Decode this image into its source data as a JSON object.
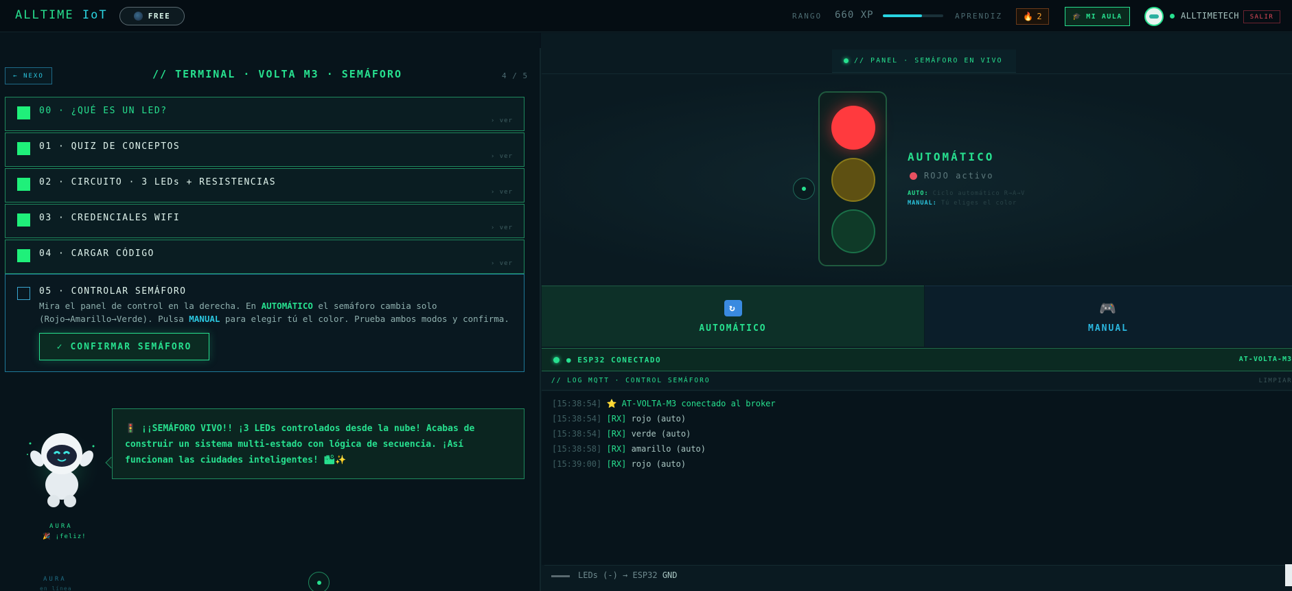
{
  "topbar": {
    "brand_main": "ALLTIME",
    "brand_iot": "IoT",
    "plan_label": "FREE",
    "rank_label": "RANGO",
    "xp_label": "660 XP",
    "xp_progress": 0.65,
    "level_label": "APRENDIZ",
    "streak_count": "2",
    "classroom_label": "MI AULA",
    "username": "ALLTIMETECH",
    "logout_label": "SALIR"
  },
  "lesson": {
    "back_label": "← NEXO",
    "title": "// TERMINAL · VOLTA M3 · SEMÁFORO",
    "progress": "4 / 5",
    "steps": [
      {
        "label": "00 · ¿QUÉ ES UN LED?",
        "view": "› ver"
      },
      {
        "label": "01 · QUIZ DE CONCEPTOS",
        "view": "› ver"
      },
      {
        "label": "02 · CIRCUITO · 3 LEDs + RESISTENCIAS",
        "view": "› ver"
      },
      {
        "label": "03 · CREDENCIALES WIFI",
        "view": "› ver"
      },
      {
        "label": "04 · CARGAR CÓDIGO",
        "view": "› ver"
      }
    ],
    "active_step": {
      "label": "05 · CONTROLAR SEMÁFORO",
      "desc_1": "Mira el panel de control en la derecha. En ",
      "desc_auto": "AUTOMÁTICO",
      "desc_2": " el semáforo cambia solo (Rojo→Amarillo→Verde). Pulsa ",
      "desc_manual": "MANUAL",
      "desc_3": " para elegir tú el color. Prueba ambos modos y confirma.",
      "confirm_label": "CONFIRMAR SEMÁFORO",
      "confirm_check": "✓"
    }
  },
  "mascot": {
    "message": "🚦 ¡¡SEMÁFORO VIVO!! ¡3 LEDs controlados desde la nube! Acabas de construir un sistema multi-estado con lógica de secuencia. ¡Así funcionan las ciudades inteligentes! 🏙✨",
    "name": "AURA",
    "mood": "🎉 ¡feliz!",
    "name_footer": "AURA",
    "status_footer": "en línea"
  },
  "panel": {
    "tab_label": "// PANEL · SEMÁFORO EN VIVO",
    "mode_title": "AUTOMÁTICO",
    "mode_state": "ROJO activo",
    "legend_auto_key": "AUTO:",
    "legend_auto_val": "Ciclo automático R→A→V",
    "legend_manual_key": "MANUAL:",
    "legend_manual_val": "Tú eliges el color",
    "btn_auto": "AUTOMÁTICO",
    "btn_manual": "MANUAL",
    "connection_label": "● ESP32 CONECTADO",
    "device_id": "AT-VOLTA-M3",
    "log_title": "// LOG MQTT · CONTROL SEMÁFORO",
    "log_clear": "LIMPIAR",
    "log": [
      {
        "ts": "[15:38:54]",
        "tag": "⭐",
        "msg": "AT-VOLTA-M3 conectado al broker",
        "highlight": true
      },
      {
        "ts": "[15:38:54]",
        "tag": "[RX]",
        "msg": "rojo (auto)",
        "highlight": false
      },
      {
        "ts": "[15:38:54]",
        "tag": "[RX]",
        "msg": "verde (auto)",
        "highlight": false
      },
      {
        "ts": "[15:38:58]",
        "tag": "[RX]",
        "msg": "amarillo (auto)",
        "highlight": false
      },
      {
        "ts": "[15:39:00]",
        "tag": "[RX]",
        "msg": "rojo (auto)",
        "highlight": false
      }
    ],
    "wire_text_1": "LEDs (-) → ESP32 ",
    "wire_text_2": "GND"
  },
  "colors": {
    "accent": "#27e08f",
    "cyan": "#2bc7e0",
    "red_led": "#ff3a3e",
    "yellow_led_off": "#5e5012",
    "green_led_off": "#0f3a28"
  }
}
